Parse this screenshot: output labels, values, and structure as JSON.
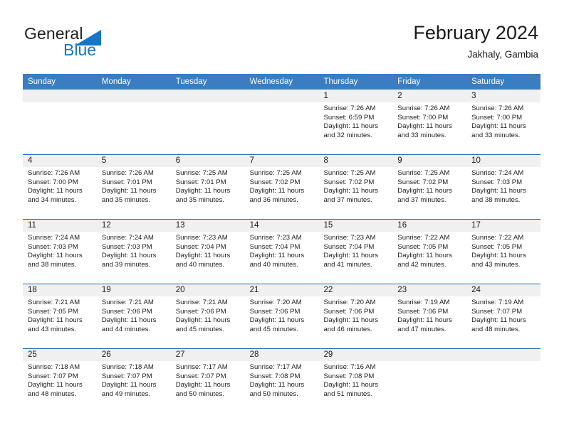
{
  "brand": {
    "name_part1": "General",
    "name_part2": "Blue",
    "mark": "triangle-logo-icon",
    "accent_color": "#1575c6"
  },
  "header": {
    "title": "February 2024",
    "subtitle": "Jakhaly, Gambia"
  },
  "colors": {
    "header_row_bg": "#3a7dc0",
    "band_bg": "#f0f0f0",
    "week_separator": "#1f6cb0",
    "text": "#1a1a1a"
  },
  "weekdays": [
    "Sunday",
    "Monday",
    "Tuesday",
    "Wednesday",
    "Thursday",
    "Friday",
    "Saturday"
  ],
  "weeks": [
    [
      {
        "day": "",
        "sunrise": "",
        "sunset": "",
        "daylight_line1": "",
        "daylight_line2": ""
      },
      {
        "day": "",
        "sunrise": "",
        "sunset": "",
        "daylight_line1": "",
        "daylight_line2": ""
      },
      {
        "day": "",
        "sunrise": "",
        "sunset": "",
        "daylight_line1": "",
        "daylight_line2": ""
      },
      {
        "day": "",
        "sunrise": "",
        "sunset": "",
        "daylight_line1": "",
        "daylight_line2": ""
      },
      {
        "day": "1",
        "sunrise": "Sunrise: 7:26 AM",
        "sunset": "Sunset: 6:59 PM",
        "daylight_line1": "Daylight: 11 hours",
        "daylight_line2": "and 32 minutes."
      },
      {
        "day": "2",
        "sunrise": "Sunrise: 7:26 AM",
        "sunset": "Sunset: 7:00 PM",
        "daylight_line1": "Daylight: 11 hours",
        "daylight_line2": "and 33 minutes."
      },
      {
        "day": "3",
        "sunrise": "Sunrise: 7:26 AM",
        "sunset": "Sunset: 7:00 PM",
        "daylight_line1": "Daylight: 11 hours",
        "daylight_line2": "and 33 minutes."
      }
    ],
    [
      {
        "day": "4",
        "sunrise": "Sunrise: 7:26 AM",
        "sunset": "Sunset: 7:00 PM",
        "daylight_line1": "Daylight: 11 hours",
        "daylight_line2": "and 34 minutes."
      },
      {
        "day": "5",
        "sunrise": "Sunrise: 7:26 AM",
        "sunset": "Sunset: 7:01 PM",
        "daylight_line1": "Daylight: 11 hours",
        "daylight_line2": "and 35 minutes."
      },
      {
        "day": "6",
        "sunrise": "Sunrise: 7:25 AM",
        "sunset": "Sunset: 7:01 PM",
        "daylight_line1": "Daylight: 11 hours",
        "daylight_line2": "and 35 minutes."
      },
      {
        "day": "7",
        "sunrise": "Sunrise: 7:25 AM",
        "sunset": "Sunset: 7:02 PM",
        "daylight_line1": "Daylight: 11 hours",
        "daylight_line2": "and 36 minutes."
      },
      {
        "day": "8",
        "sunrise": "Sunrise: 7:25 AM",
        "sunset": "Sunset: 7:02 PM",
        "daylight_line1": "Daylight: 11 hours",
        "daylight_line2": "and 37 minutes."
      },
      {
        "day": "9",
        "sunrise": "Sunrise: 7:25 AM",
        "sunset": "Sunset: 7:02 PM",
        "daylight_line1": "Daylight: 11 hours",
        "daylight_line2": "and 37 minutes."
      },
      {
        "day": "10",
        "sunrise": "Sunrise: 7:24 AM",
        "sunset": "Sunset: 7:03 PM",
        "daylight_line1": "Daylight: 11 hours",
        "daylight_line2": "and 38 minutes."
      }
    ],
    [
      {
        "day": "11",
        "sunrise": "Sunrise: 7:24 AM",
        "sunset": "Sunset: 7:03 PM",
        "daylight_line1": "Daylight: 11 hours",
        "daylight_line2": "and 38 minutes."
      },
      {
        "day": "12",
        "sunrise": "Sunrise: 7:24 AM",
        "sunset": "Sunset: 7:03 PM",
        "daylight_line1": "Daylight: 11 hours",
        "daylight_line2": "and 39 minutes."
      },
      {
        "day": "13",
        "sunrise": "Sunrise: 7:23 AM",
        "sunset": "Sunset: 7:04 PM",
        "daylight_line1": "Daylight: 11 hours",
        "daylight_line2": "and 40 minutes."
      },
      {
        "day": "14",
        "sunrise": "Sunrise: 7:23 AM",
        "sunset": "Sunset: 7:04 PM",
        "daylight_line1": "Daylight: 11 hours",
        "daylight_line2": "and 40 minutes."
      },
      {
        "day": "15",
        "sunrise": "Sunrise: 7:23 AM",
        "sunset": "Sunset: 7:04 PM",
        "daylight_line1": "Daylight: 11 hours",
        "daylight_line2": "and 41 minutes."
      },
      {
        "day": "16",
        "sunrise": "Sunrise: 7:22 AM",
        "sunset": "Sunset: 7:05 PM",
        "daylight_line1": "Daylight: 11 hours",
        "daylight_line2": "and 42 minutes."
      },
      {
        "day": "17",
        "sunrise": "Sunrise: 7:22 AM",
        "sunset": "Sunset: 7:05 PM",
        "daylight_line1": "Daylight: 11 hours",
        "daylight_line2": "and 43 minutes."
      }
    ],
    [
      {
        "day": "18",
        "sunrise": "Sunrise: 7:21 AM",
        "sunset": "Sunset: 7:05 PM",
        "daylight_line1": "Daylight: 11 hours",
        "daylight_line2": "and 43 minutes."
      },
      {
        "day": "19",
        "sunrise": "Sunrise: 7:21 AM",
        "sunset": "Sunset: 7:06 PM",
        "daylight_line1": "Daylight: 11 hours",
        "daylight_line2": "and 44 minutes."
      },
      {
        "day": "20",
        "sunrise": "Sunrise: 7:21 AM",
        "sunset": "Sunset: 7:06 PM",
        "daylight_line1": "Daylight: 11 hours",
        "daylight_line2": "and 45 minutes."
      },
      {
        "day": "21",
        "sunrise": "Sunrise: 7:20 AM",
        "sunset": "Sunset: 7:06 PM",
        "daylight_line1": "Daylight: 11 hours",
        "daylight_line2": "and 45 minutes."
      },
      {
        "day": "22",
        "sunrise": "Sunrise: 7:20 AM",
        "sunset": "Sunset: 7:06 PM",
        "daylight_line1": "Daylight: 11 hours",
        "daylight_line2": "and 46 minutes."
      },
      {
        "day": "23",
        "sunrise": "Sunrise: 7:19 AM",
        "sunset": "Sunset: 7:06 PM",
        "daylight_line1": "Daylight: 11 hours",
        "daylight_line2": "and 47 minutes."
      },
      {
        "day": "24",
        "sunrise": "Sunrise: 7:19 AM",
        "sunset": "Sunset: 7:07 PM",
        "daylight_line1": "Daylight: 11 hours",
        "daylight_line2": "and 48 minutes."
      }
    ],
    [
      {
        "day": "25",
        "sunrise": "Sunrise: 7:18 AM",
        "sunset": "Sunset: 7:07 PM",
        "daylight_line1": "Daylight: 11 hours",
        "daylight_line2": "and 48 minutes."
      },
      {
        "day": "26",
        "sunrise": "Sunrise: 7:18 AM",
        "sunset": "Sunset: 7:07 PM",
        "daylight_line1": "Daylight: 11 hours",
        "daylight_line2": "and 49 minutes."
      },
      {
        "day": "27",
        "sunrise": "Sunrise: 7:17 AM",
        "sunset": "Sunset: 7:07 PM",
        "daylight_line1": "Daylight: 11 hours",
        "daylight_line2": "and 50 minutes."
      },
      {
        "day": "28",
        "sunrise": "Sunrise: 7:17 AM",
        "sunset": "Sunset: 7:08 PM",
        "daylight_line1": "Daylight: 11 hours",
        "daylight_line2": "and 50 minutes."
      },
      {
        "day": "29",
        "sunrise": "Sunrise: 7:16 AM",
        "sunset": "Sunset: 7:08 PM",
        "daylight_line1": "Daylight: 11 hours",
        "daylight_line2": "and 51 minutes."
      },
      {
        "day": "",
        "sunrise": "",
        "sunset": "",
        "daylight_line1": "",
        "daylight_line2": ""
      },
      {
        "day": "",
        "sunrise": "",
        "sunset": "",
        "daylight_line1": "",
        "daylight_line2": ""
      }
    ]
  ]
}
